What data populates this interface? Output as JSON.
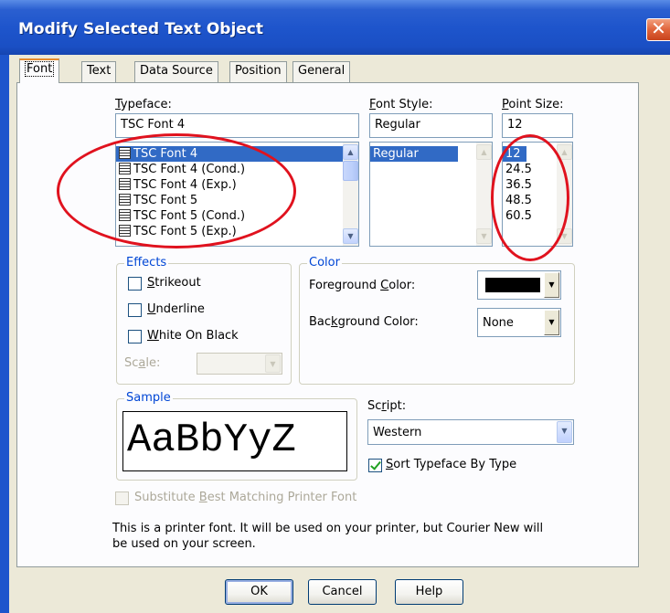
{
  "dialog": {
    "title": "Modify Selected Text Object",
    "close_glyph": "✕"
  },
  "tabs": [
    {
      "label": "Font",
      "active": true
    },
    {
      "label": "Text"
    },
    {
      "label": "Data Source"
    },
    {
      "label": "Position"
    },
    {
      "label": "General"
    }
  ],
  "typeface": {
    "label_pre": "",
    "label_accel": "T",
    "label_post": "ypeface:",
    "value": "TSC Font 4",
    "items": [
      "TSC Font 4",
      "TSC Font 4 (Cond.)",
      "TSC Font 4 (Exp.)",
      "TSC Font 5",
      "TSC Font 5 (Cond.)",
      "TSC Font 5 (Exp.)"
    ],
    "item_icon": "printer-font-icon"
  },
  "font_style": {
    "label_pre": "",
    "label_accel": "F",
    "label_post": "ont Style:",
    "value": "Regular",
    "items": [
      "Regular"
    ]
  },
  "point_size": {
    "label_pre": "",
    "label_accel": "P",
    "label_post": "oint Size:",
    "value": "12",
    "items": [
      "12",
      "24.5",
      "36.5",
      "48.5",
      "60.5"
    ]
  },
  "effects": {
    "title": "Effects",
    "strikeout": {
      "pre": "",
      "accel": "S",
      "post": "trikeout",
      "checked": false
    },
    "underline": {
      "pre": "",
      "accel": "U",
      "post": "nderline",
      "checked": false
    },
    "white_on_black": {
      "pre": "",
      "accel": "W",
      "post": "hite On Black",
      "checked": false
    },
    "scale_label_pre": "Sc",
    "scale_label_accel": "a",
    "scale_label_post": "le:",
    "scale_value": ""
  },
  "color": {
    "title": "Color",
    "foreground_pre": "Foreground ",
    "foreground_accel": "C",
    "foreground_post": "olor:",
    "foreground_value": "#000000",
    "background_pre": "Bac",
    "background_accel": "k",
    "background_post": "ground Color:",
    "background_value": "None"
  },
  "sample": {
    "title": "Sample",
    "text": "AaBbYyZ"
  },
  "script": {
    "label_pre": "Sc",
    "label_accel": "r",
    "label_post": "ipt:",
    "value": "Western"
  },
  "sort_typeface": {
    "pre": "",
    "accel": "S",
    "post": "ort Typeface By Type",
    "checked": true
  },
  "substitute": {
    "pre": "Substitute ",
    "accel": "B",
    "post": "est Matching Printer Font",
    "checked": false
  },
  "info_text_line1": "This is a printer font. It will be used on your printer, but Courier New will",
  "info_text_line2": "be used on your screen.",
  "buttons": {
    "ok": "OK",
    "cancel": "Cancel",
    "help": "Help"
  },
  "colors": {
    "title_bar": "#1e55cc",
    "annotation": "#e0121e",
    "selection": "#316ac5",
    "group_title": "#0046d5"
  }
}
